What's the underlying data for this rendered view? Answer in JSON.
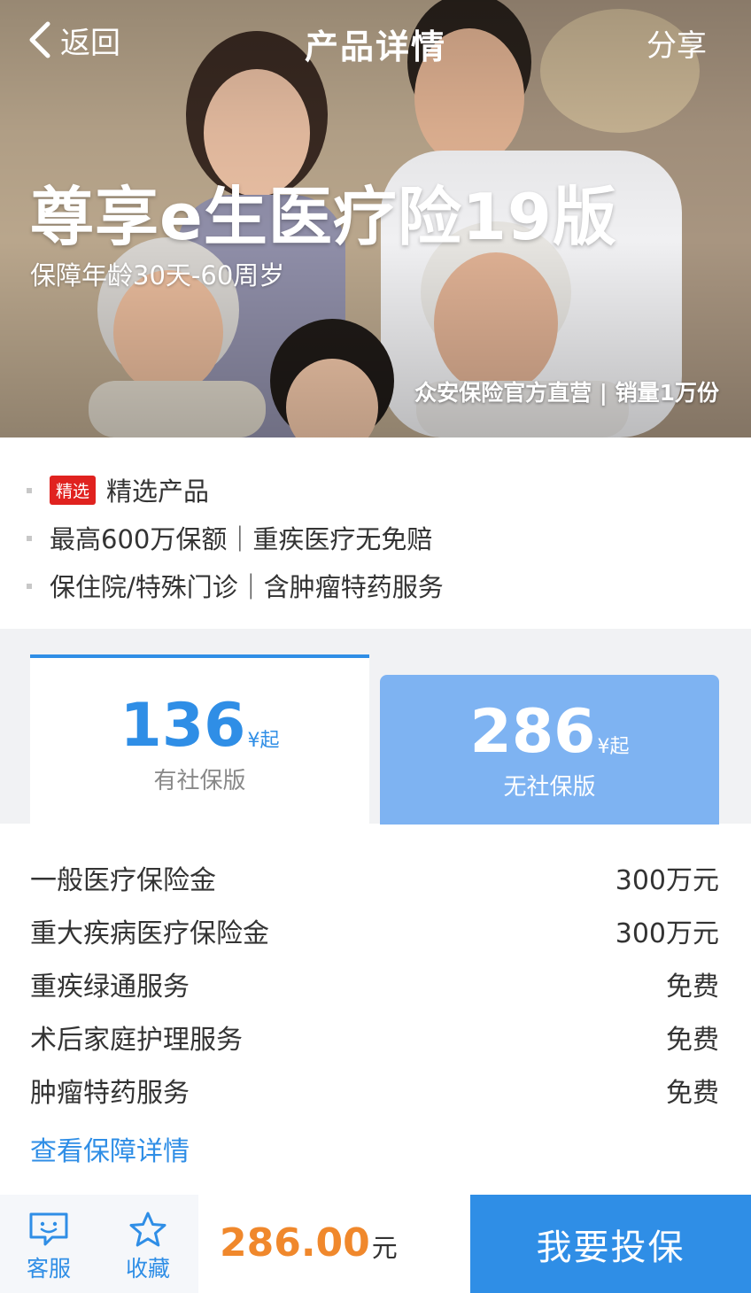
{
  "nav": {
    "back_label": "返回",
    "title": "产品详情",
    "share_label": "分享"
  },
  "hero": {
    "product_name": "尊享e生医疗险19版",
    "age_range": "保障年龄30天-60周岁",
    "sales_info": "众安保险官方直营 | 销量1万份"
  },
  "features": [
    {
      "tag": "精选",
      "text": "精选产品"
    },
    {
      "text": "最高600万保额｜重疾医疗无免赔"
    },
    {
      "text": "保住院/特殊门诊｜含肿瘤特药服务"
    }
  ],
  "plans": [
    {
      "price": "136",
      "unit": "¥起",
      "label": "有社保版",
      "selected": true
    },
    {
      "price": "286",
      "unit": "¥起",
      "label": "无社保版",
      "selected": false
    }
  ],
  "coverage": [
    {
      "name": "一般医疗保险金",
      "value": "300万元"
    },
    {
      "name": "重大疾病医疗保险金",
      "value": "300万元"
    },
    {
      "name": "重疾绿通服务",
      "value": "免费"
    },
    {
      "name": "术后家庭护理服务",
      "value": "免费"
    },
    {
      "name": "肿瘤特药服务",
      "value": "免费"
    }
  ],
  "detail_link": "查看保障详情",
  "bottom": {
    "customer_service": "客服",
    "favorite": "收藏",
    "price": "286.00",
    "currency": "元",
    "buy_label": "我要投保"
  },
  "colors": {
    "accent": "#2f8ee6",
    "price_orange": "#f0882c",
    "tag_red": "#e0221f",
    "plan_inactive": "#7eb3f2"
  }
}
